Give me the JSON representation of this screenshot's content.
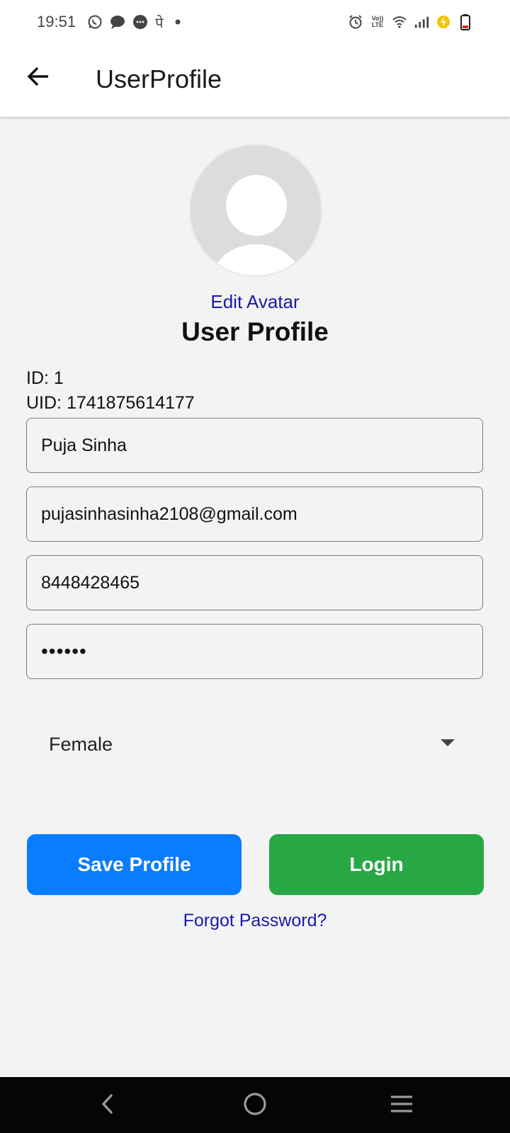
{
  "status_bar": {
    "time": "19:51",
    "hindi_glyph": "पे",
    "volte_line1": "Vo))",
    "volte_line2": "LTE",
    "left_icons": [
      "whatsapp-icon",
      "message-icon",
      "chat-icon",
      "phonepe-icon",
      "dot-icon"
    ],
    "right_icons": [
      "alarm-icon",
      "volte-icon",
      "wifi-icon",
      "signal-icon",
      "battery-saver-icon",
      "battery-icon"
    ]
  },
  "app_bar": {
    "title": "UserProfile",
    "back_icon": "arrow-left-icon"
  },
  "profile": {
    "edit_avatar_label": "Edit Avatar",
    "section_title": "User Profile",
    "id_line": "ID: 1",
    "uid_line": "UID: 1741875614177"
  },
  "form": {
    "name_value": "Puja Sinha",
    "email_value": "pujasinhasinha2108@gmail.com",
    "phone_value": "8448428465",
    "password_value": "••••••",
    "gender_value": "Female"
  },
  "actions": {
    "save_label": "Save Profile",
    "login_label": "Login",
    "forgot_label": "Forgot Password?"
  },
  "colors": {
    "save_button": "#0a7cff",
    "login_button": "#28a745",
    "link": "#1a1aa8",
    "background": "#f3f3f3"
  },
  "nav_bar": {
    "icons": [
      "nav-back-icon",
      "nav-home-icon",
      "nav-recents-icon"
    ]
  }
}
